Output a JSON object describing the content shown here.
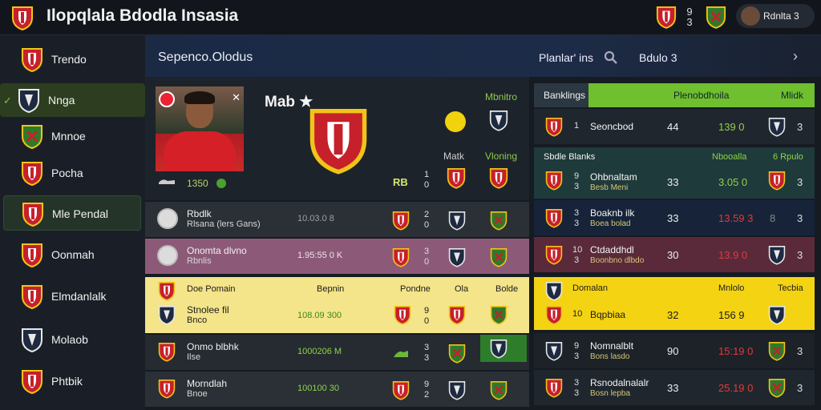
{
  "app": {
    "title": "Ilopqlala Bdodla Insasia"
  },
  "topbar": {
    "num_a": "9",
    "num_b": "3",
    "user_name": "Rdnlta 3"
  },
  "sidebar": {
    "items": [
      {
        "label": "Trendo"
      },
      {
        "label": "Nnga"
      },
      {
        "label": "Mnnoe"
      },
      {
        "label": "Pocha"
      },
      {
        "label": "Mle Pendal"
      },
      {
        "label": "Oonmah"
      },
      {
        "label": "Elmdanlalk"
      },
      {
        "label": "Molaob"
      },
      {
        "label": "Phtbik"
      }
    ]
  },
  "header": {
    "section_title": "Sepenco.Olodus",
    "search_label": "Planlar' ins",
    "badge_label": "Bdulo 3"
  },
  "feature": {
    "title": "Mab ★",
    "score": "1350",
    "col_monitor": "Mbnitro",
    "col_match": "Matk",
    "col_viewing": "Vloning",
    "rb_label": "RB",
    "rb_stack": [
      "1",
      "0"
    ]
  },
  "rows": [
    {
      "name": "Rbdlk",
      "sub": "Rlsana (lers Gans)",
      "stat": "10.03.0 8",
      "stack": [
        "2",
        "0"
      ]
    },
    {
      "name": "Onomta dlvno",
      "sub": "Rbnlis",
      "stat": "1.95:55 0 K",
      "stack": [
        "3",
        "0"
      ]
    },
    {
      "head_name": "Doe Pomain",
      "head_col1": "Bepnin",
      "head_col2": "Pondne",
      "head_col3": "Ola",
      "head_col4": "Bolde",
      "name": "Stnolee fil",
      "sub": "Bnco",
      "stat": "108.09 300",
      "stack": [
        "9",
        "0"
      ]
    },
    {
      "name": "Onmo blbhk",
      "sub": "Ilse",
      "stat": "1000206 M",
      "stack": [
        "3",
        "3"
      ]
    },
    {
      "name": "Morndlah",
      "sub": "Bnoe",
      "stat": "100100 30",
      "stack": [
        "9",
        "2"
      ]
    }
  ],
  "rankings": {
    "header": {
      "title": "Banklings",
      "col1": "Plenobdhoila",
      "col2": "Mlidk"
    },
    "rows": [
      {
        "stack": [
          "1"
        ],
        "name": "Seoncbod",
        "sub": "",
        "num": "44",
        "score": "139 0",
        "end": "3",
        "score_color": "#8fd14a"
      },
      {
        "stack": [
          "9",
          "3"
        ],
        "name": "Ohbnaltam",
        "sub": "Besb Meni",
        "num": "33",
        "score": "3.05 0",
        "end": "3",
        "score_color": "#8fd14a",
        "sub_head": "Sbdle Blanks",
        "sub_head_c1": "Nbooalla",
        "sub_head_c2": "6 Rpulo"
      },
      {
        "stack": [
          "3",
          "3"
        ],
        "name": "Boaknb ilk",
        "sub": "Boea bolad",
        "num": "33",
        "score": "13.59 3",
        "end": "8",
        "score_color": "#e03a3a",
        "end2": "3"
      },
      {
        "stack": [
          "10",
          "3"
        ],
        "name": "Ctdaddhdl",
        "sub": "Boonbno dlbdo",
        "num": "30",
        "score": "13.9 0",
        "end": "3",
        "score_color": "#e03a3a"
      },
      {
        "stack": [
          "10"
        ],
        "name": "Bqpbiaa",
        "sub": "",
        "num": "32",
        "score": "156 9",
        "end": "",
        "score_color": "#1c1c1c",
        "head_name": "Domalan",
        "head_c1": "Mnlolo",
        "head_c2": "Tecbia"
      },
      {
        "stack": [
          "9",
          "3"
        ],
        "name": "Nomnalblt",
        "sub": "Bons lasdo",
        "num": "90",
        "score": "15:19 0",
        "end": "3",
        "score_color": "#e03a3a"
      },
      {
        "stack": [
          "3",
          "3"
        ],
        "name": "Rsnodalnalalr",
        "sub": "Bosn lepba",
        "num": "33",
        "score": "25.19 0",
        "end": "3",
        "score_color": "#e03a3a"
      }
    ]
  }
}
